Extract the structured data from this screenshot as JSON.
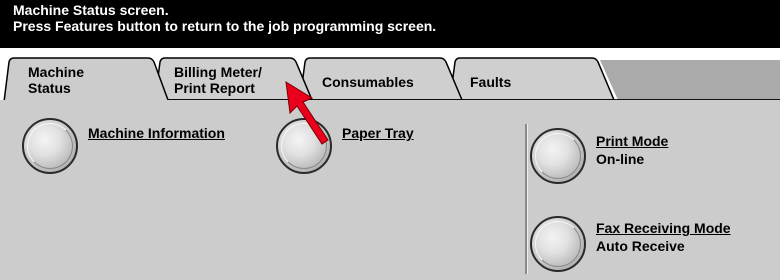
{
  "header": {
    "line1": "Machine Status screen.",
    "line2": "Press Features button to return to the job programming screen."
  },
  "tabs": [
    {
      "label": "Machine\nStatus",
      "active": true
    },
    {
      "label": "Billing Meter/\nPrint Report",
      "active": false
    },
    {
      "label": "Consumables",
      "active": false
    },
    {
      "label": "Faults",
      "active": false
    }
  ],
  "buttons": {
    "machine_information": {
      "label": "Machine Information"
    },
    "paper_tray": {
      "label": "Paper Tray"
    },
    "print_mode": {
      "label": "Print Mode",
      "value": "On-line"
    },
    "fax_receiving_mode": {
      "label": "Fax Receiving Mode",
      "value": "Auto Receive"
    }
  },
  "colors": {
    "header_bg": "#000000",
    "panel_bg": "#cccccc",
    "arrow": "#e8001c"
  },
  "icons": {
    "pointer": "red-arrow-icon"
  }
}
